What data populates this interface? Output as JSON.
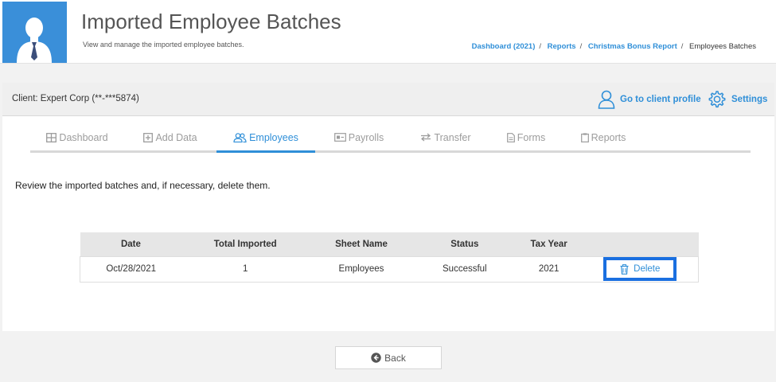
{
  "header": {
    "title": "Imported Employee Batches",
    "subtitle": "View and manage the imported employee batches.",
    "breadcrumb": [
      "Dashboard (2021)",
      "Reports",
      "Christmas Bonus Report",
      "Employees Batches"
    ]
  },
  "client": {
    "label": "Client: Expert Corp (**-***5874)",
    "profile_link": "Go to client profile",
    "settings_link": "Settings"
  },
  "tabs": [
    {
      "label": "Dashboard",
      "icon": "grid-icon"
    },
    {
      "label": "Add Data",
      "icon": "plus-square-icon"
    },
    {
      "label": "Employees",
      "icon": "users-icon",
      "active": true
    },
    {
      "label": "Payrolls",
      "icon": "payroll-icon"
    },
    {
      "label": "Transfer",
      "icon": "transfer-icon"
    },
    {
      "label": "Forms",
      "icon": "document-icon"
    },
    {
      "label": "Reports",
      "icon": "clipboard-icon"
    }
  ],
  "instructions": "Review the imported batches and, if necessary, delete them.",
  "table": {
    "headers": [
      "Date",
      "Total Imported",
      "Sheet Name",
      "Status",
      "Tax Year",
      ""
    ],
    "rows": [
      {
        "date": "Oct/28/2021",
        "total": "1",
        "sheet": "Employees",
        "status": "Successful",
        "year": "2021",
        "action": "Delete"
      }
    ]
  },
  "footer": {
    "back_label": "Back"
  },
  "colors": {
    "accent": "#2f8fd8",
    "avatar_bg": "#3a8fd9",
    "highlight_border": "#1a6fe0"
  }
}
